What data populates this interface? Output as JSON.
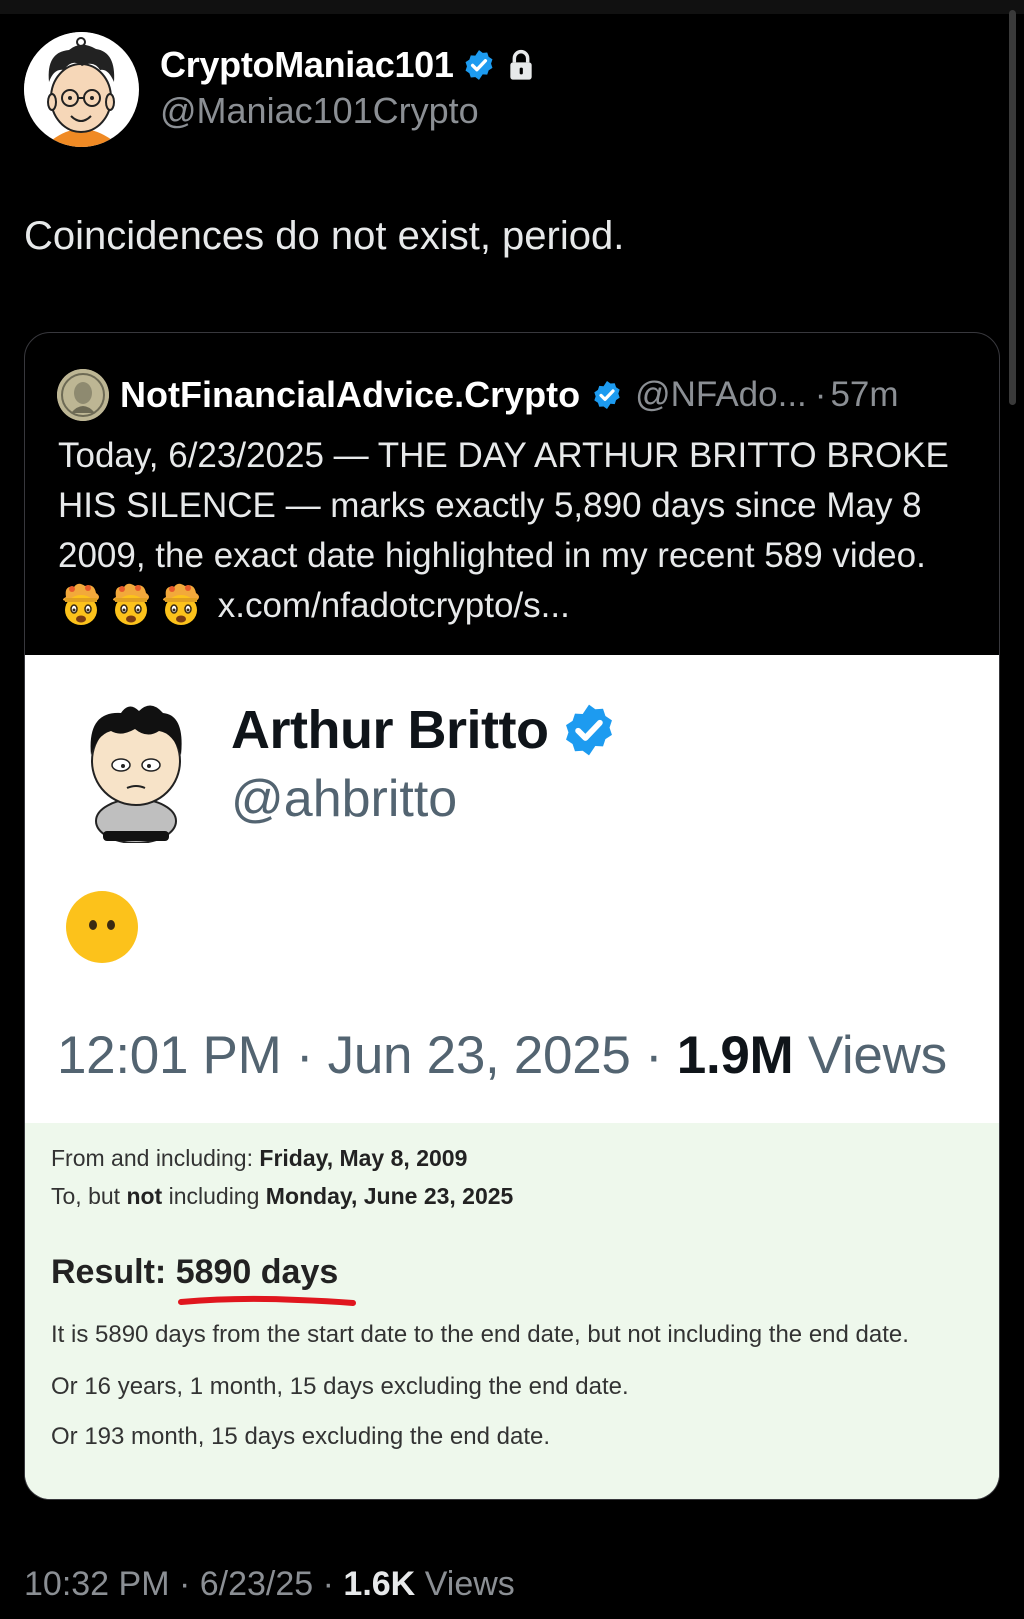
{
  "post": {
    "display_name": "CryptoManiac101",
    "handle": "@Maniac101Crypto",
    "text": "Coincidences do not exist, period.",
    "footer_time": "10:32 PM",
    "footer_date": "6/23/25",
    "footer_views_count": "1.6K",
    "footer_views_label": "Views",
    "separator": " · "
  },
  "quote": {
    "display_name": "NotFinancialAdvice.Crypto",
    "handle": "@NFAdo...",
    "dot": "·",
    "time": "57m",
    "text_before_emoji": "Today, 6/23/2025 — THE DAY ARTHUR BRITTO BROKE HIS SILENCE — marks exactly 5,890 days since May 8 2009, the exact date highlighted in my recent 589 video. ",
    "text_after_emoji": " x.com/nfadotcrypto/s..."
  },
  "embedded": {
    "display_name": "Arthur Britto",
    "handle": "@ahbritto",
    "time": "12:01 PM",
    "date": "Jun 23, 2025",
    "views_count": "1.9M",
    "views_label": "Views",
    "separator": " · "
  },
  "calc": {
    "from_label": "From and including: ",
    "from_value": "Friday, May 8, 2009",
    "to_label_1": "To, but ",
    "to_not": "not",
    "to_label_2": " including ",
    "to_value": "Monday, June 23, 2025",
    "result_label": "Result: ",
    "result_value": "5890 days",
    "desc1": "It is 5890 days from the start date to the end date, but not including the end date.",
    "desc2": "Or 16 years, 1 month, 15 days excluding the end date.",
    "desc3": "Or 193 month, 15 days excluding the end date."
  },
  "icons": {
    "verified": "verified-badge-icon",
    "lock": "lock-icon",
    "mind_blown": "exploding-head-emoji",
    "face": "face-without-mouth-emoji"
  },
  "colors": {
    "verified_blue": "#1d9bf0",
    "result_underline": "#e0161e",
    "calc_background": "#eef8ec"
  }
}
